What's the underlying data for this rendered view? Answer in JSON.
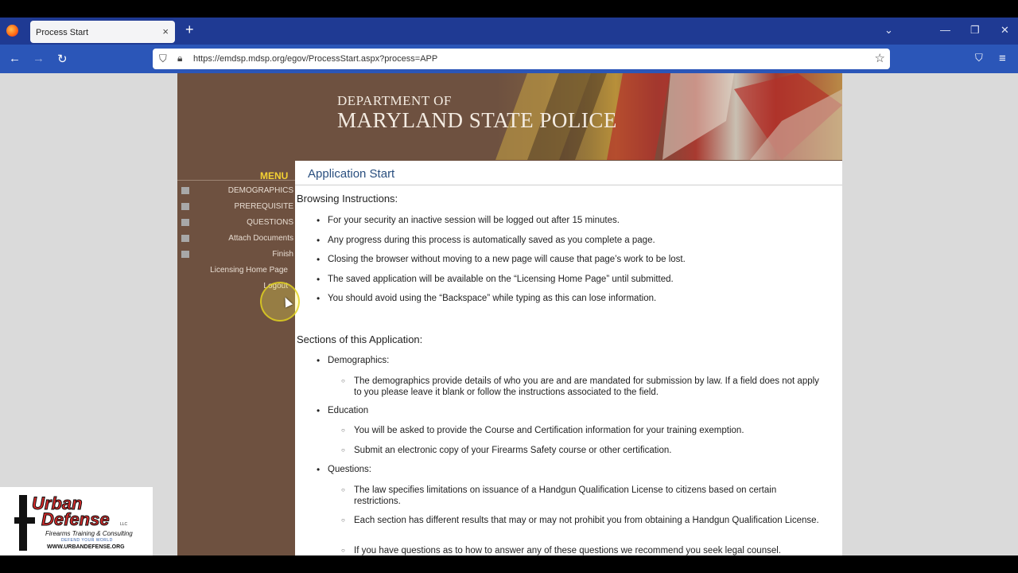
{
  "browser": {
    "tab_title": "Process Start",
    "tab_close": "×",
    "new_tab": "+",
    "url": "https://emdsp.mdsp.org/egov/ProcessStart.aspx?process=APP",
    "controls": {
      "list_all": "⌄",
      "minimize": "—",
      "restore": "❐",
      "close": "✕"
    },
    "nav": {
      "back": "←",
      "forward": "→",
      "reload": "↻",
      "pocket": "⛉",
      "menu": "≡"
    }
  },
  "banner": {
    "dept": "DEPARTMENT OF",
    "agency": "MARYLAND STATE POLICE"
  },
  "menu": {
    "title": "MENU",
    "items": [
      {
        "label": "DEMOGRAPHICS"
      },
      {
        "label": "PREREQUISITE"
      },
      {
        "label": "QUESTIONS"
      },
      {
        "label": "Attach Documents"
      },
      {
        "label": "Finish"
      }
    ],
    "links": [
      {
        "label": "Licensing Home Page"
      },
      {
        "label": "Logout"
      }
    ]
  },
  "content": {
    "title": "Application Start",
    "browsing_heading": "Browsing Instructions:",
    "browsing": [
      "For your security an inactive session will be logged out after 15 minutes.",
      "Any progress during this process is automatically saved as you complete a page.",
      "Closing the browser without moving to a new page will cause that page’s work to be lost.",
      "The saved application will be available on the “Licensing Home Page” until submitted.",
      "You should avoid using the “Backspace” while typing as this can lose information."
    ],
    "sections_heading": "Sections of this Application:",
    "sections": [
      {
        "name": "Demographics:",
        "details": [
          "The demographics provide details of who you are and are mandated for submission by law. If a field does not apply to you please leave it blank or follow the instructions associated to the field."
        ]
      },
      {
        "name": "Education",
        "details": [
          "You will be asked to provide the Course and Certification information for your training exemption.",
          "Submit an electronic copy of your Firearms Safety course or other certification."
        ]
      },
      {
        "name": "Questions:",
        "details": [
          "The law specifies limitations on issuance of a Handgun Qualification License to citizens based on certain restrictions.",
          "Each section has different results that may or may not prohibit you from obtaining a Handgun Qualification License.",
          "If you have questions as to how to answer any of these questions we recommend you seek legal counsel."
        ]
      }
    ]
  },
  "watermark": {
    "line1": "Urban",
    "line2": "Defense",
    "llc": "LLC",
    "tagline": "Firearms Training & Consulting",
    "motto": "DEFEND YOUR WORLD",
    "site": "WWW.URBANDEFENSE.ORG"
  },
  "colors": {
    "tab_strip": "#1f3a93",
    "nav_bar": "#2b56b8",
    "sidebar": "#6e5140",
    "menu_title": "#f4d233",
    "page_title": "#2a4f7f"
  }
}
